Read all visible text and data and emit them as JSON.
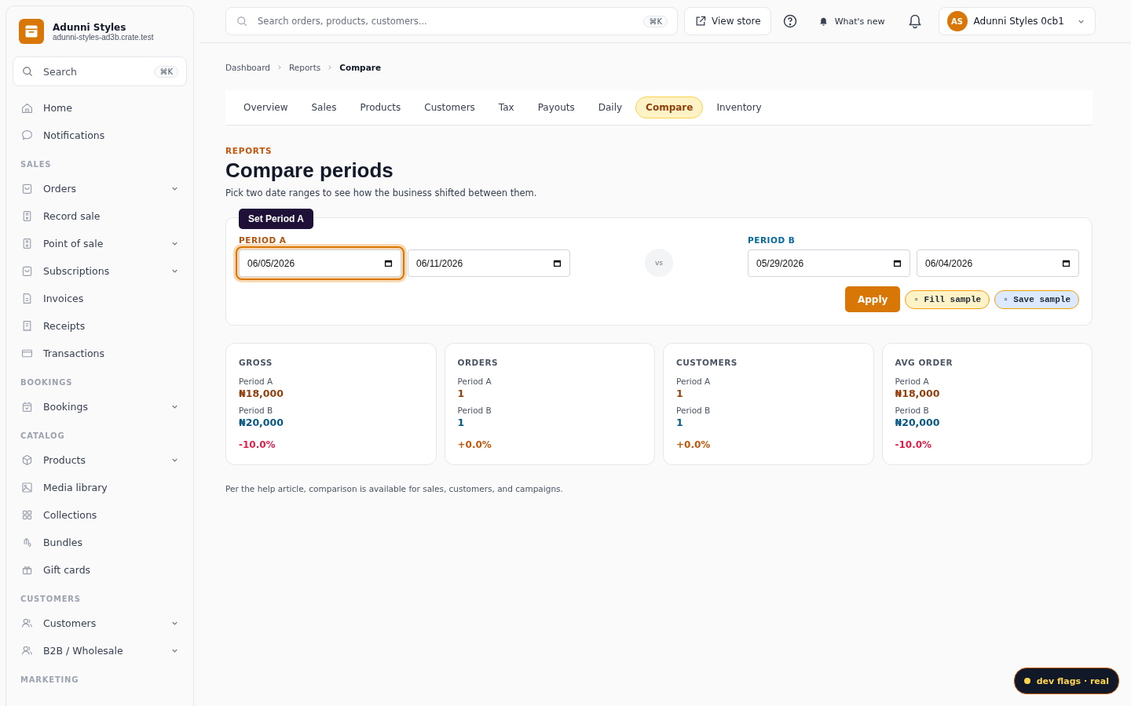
{
  "brand": {
    "name": "Adunni Styles",
    "domain": "adunni-styles-ad3b.crate.test"
  },
  "sidebar": {
    "search": {
      "placeholder": "Search",
      "shortcut": "⌘K"
    },
    "sections": [
      {
        "items": [
          {
            "label": "Home",
            "kind": "home",
            "expandable": false
          },
          {
            "label": "Notifications",
            "kind": "chat",
            "expandable": false
          }
        ]
      },
      {
        "title": "SALES",
        "items": [
          {
            "label": "Orders",
            "kind": "bag",
            "expandable": true
          },
          {
            "label": "Record sale",
            "kind": "device",
            "expandable": false
          },
          {
            "label": "Point of sale",
            "kind": "device",
            "expandable": true
          },
          {
            "label": "Subscriptions",
            "kind": "bag",
            "expandable": true
          },
          {
            "label": "Invoices",
            "kind": "doc",
            "expandable": false
          },
          {
            "label": "Receipts",
            "kind": "receipt",
            "expandable": false
          },
          {
            "label": "Transactions",
            "kind": "card",
            "expandable": false
          }
        ]
      },
      {
        "title": "BOOKINGS",
        "items": [
          {
            "label": "Bookings",
            "kind": "calendar",
            "expandable": true
          }
        ]
      },
      {
        "title": "CATALOG",
        "items": [
          {
            "label": "Products",
            "kind": "cube",
            "expandable": true
          },
          {
            "label": "Media library",
            "kind": "image",
            "expandable": false
          },
          {
            "label": "Collections",
            "kind": "grid",
            "expandable": false
          },
          {
            "label": "Bundles",
            "kind": "bundle",
            "expandable": false
          },
          {
            "label": "Gift cards",
            "kind": "gift",
            "expandable": false
          }
        ]
      },
      {
        "title": "CUSTOMERS",
        "items": [
          {
            "label": "Customers",
            "kind": "users",
            "expandable": true
          },
          {
            "label": "B2B / Wholesale",
            "kind": "users",
            "expandable": true
          }
        ]
      },
      {
        "title": "MARKETING"
      }
    ]
  },
  "topbar": {
    "search": {
      "placeholder": "Search orders, products, customers...",
      "shortcut": "⌘K"
    },
    "view_store": "View store",
    "whats_new": "What's new",
    "account": {
      "initials": "AS",
      "name": "Adunni Styles 0cb1"
    }
  },
  "breadcrumb": [
    {
      "label": "Dashboard",
      "current": false
    },
    {
      "label": "Reports",
      "current": false
    },
    {
      "label": "Compare",
      "current": true
    }
  ],
  "tabs": [
    {
      "label": "Overview",
      "selected": false
    },
    {
      "label": "Sales",
      "selected": false
    },
    {
      "label": "Products",
      "selected": false
    },
    {
      "label": "Customers",
      "selected": false
    },
    {
      "label": "Tax",
      "selected": false
    },
    {
      "label": "Payouts",
      "selected": false
    },
    {
      "label": "Daily",
      "selected": false
    },
    {
      "label": "Compare",
      "selected": true
    },
    {
      "label": "Inventory",
      "selected": false
    }
  ],
  "eyebrow": "REPORTS",
  "title": "Compare periods",
  "subtitle": "Pick two date ranges to see how the business shifted between them.",
  "periods": {
    "a": {
      "label": "PERIOD A",
      "start": "06/05/2026",
      "end": "06/11/2026",
      "focused_start": true
    },
    "vs": "vs",
    "b": {
      "label": "PERIOD B",
      "start": "05/29/2026",
      "end": "06/04/2026"
    },
    "tooltip": "Set Period A",
    "apply": "Apply",
    "fill_sample": "▫ Fill sample",
    "save_sample": "▫ Save sample"
  },
  "stats": [
    {
      "title": "GROSS",
      "a_label": "Period A",
      "a_value": "₦18,000",
      "b_label": "Period B",
      "b_value": "₦20,000",
      "delta": "-10.0%",
      "color": "#e11d48"
    },
    {
      "title": "ORDERS",
      "a_label": "Period A",
      "a_value": "1",
      "b_label": "Period B",
      "b_value": "1",
      "delta": "+0.0%",
      "color": "#c2570c"
    },
    {
      "title": "CUSTOMERS",
      "a_label": "Period A",
      "a_value": "1",
      "b_label": "Period B",
      "b_value": "1",
      "delta": "+0.0%",
      "color": "#c2570c"
    },
    {
      "title": "AVG ORDER",
      "a_label": "Period A",
      "a_value": "₦18,000",
      "b_label": "Period B",
      "b_value": "₦20,000",
      "delta": "-10.0%",
      "color": "#e11d48"
    }
  ],
  "footnote": "Per the help article, comparison is available for sales, customers, and campaigns.",
  "dev_flags": "dev flags · real"
}
